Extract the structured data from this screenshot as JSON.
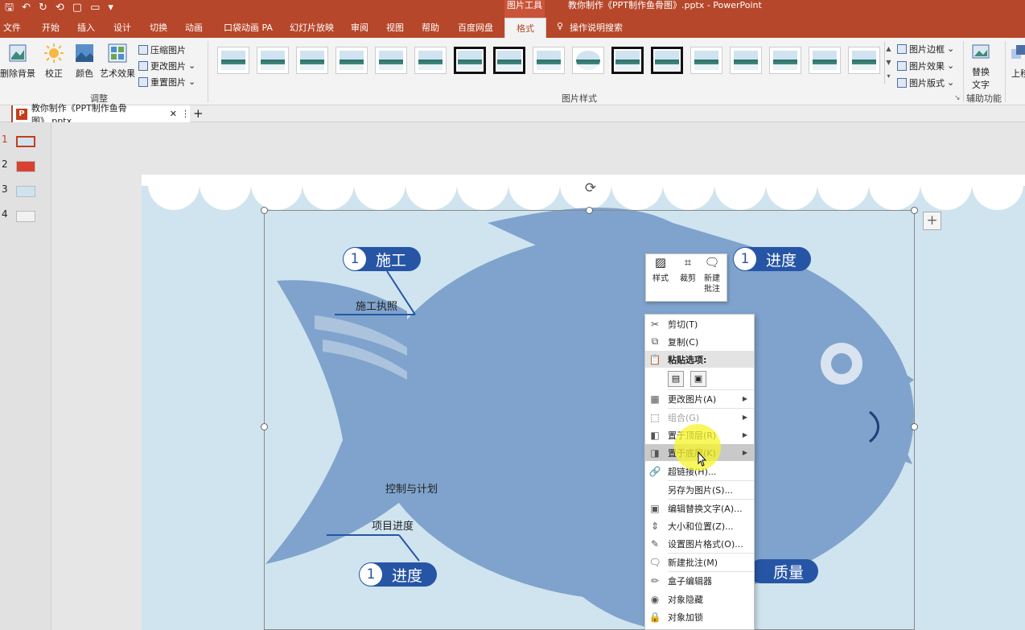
{
  "app": {
    "context_tab_label": "图片工具",
    "doc_title": "教你制作《PPT制作鱼骨图》.pptx  -  PowerPoint",
    "qat_icons": [
      "save-icon",
      "undo-icon",
      "redo-icon",
      "repeat-icon",
      "new-icon",
      "open-icon",
      "customize-icon"
    ]
  },
  "tabs": [
    "文件",
    "开始",
    "插入",
    "设计",
    "切换",
    "动画",
    "口袋动画 PA",
    "幻灯片放映",
    "审阅",
    "视图",
    "帮助",
    "百度网盘",
    "格式"
  ],
  "tell_me": "操作说明搜索",
  "ribbon": {
    "remove_bg": "删除背景",
    "correct": "校正",
    "color": "颜色",
    "artistic": "艺术效果",
    "compress": "压缩图片",
    "change": "更改图片",
    "reset": "重置图片",
    "adjust_group": "调整",
    "styles_group": "图片样式",
    "border": "图片边框",
    "effects": "图片效果",
    "layout": "图片版式",
    "alt_text_line1": "替换",
    "alt_text_line2": "文字",
    "accessibility_group": "辅助功能",
    "up": "上移"
  },
  "doctab": {
    "name": "教你制作《PPT制作鱼骨图》.pptx",
    "close": "✕",
    "more": "⋮",
    "add": "+"
  },
  "slides": [
    "1",
    "2",
    "3",
    "4"
  ],
  "slide": {
    "pill_top_left": {
      "num": "1",
      "label": "施工"
    },
    "pill_top_right": {
      "num": "1",
      "label": "进度"
    },
    "pill_bottom_left": {
      "num": "1",
      "label": "进度"
    },
    "pill_bottom_right": {
      "label": "质量"
    },
    "text_license": "施工执照",
    "text_control": "控制与计划",
    "text_progress": "项目进度"
  },
  "minibar": {
    "style": "样式",
    "crop": "裁剪",
    "comment_line1": "新建",
    "comment_line2": "批注"
  },
  "menu": {
    "cut": "剪切(T)",
    "copy": "复制(C)",
    "paste_options": "粘贴选项:",
    "change_picture": "更改图片(A)",
    "group": "组合(G)",
    "bring_front": "置于顶层(R)",
    "send_back": "置于底层(K)",
    "hyperlink": "超链接(H)...",
    "save_as": "另存为图片(S)...",
    "alt_text": "编辑替换文字(A)...",
    "size_pos": "大小和位置(Z)...",
    "format": "设置图片格式(O)...",
    "new_comment": "新建批注(M)",
    "box_editor": "盒子编辑器",
    "hide": "对象隐藏",
    "lock": "对象加锁"
  },
  "colors": {
    "accent": "#b7472a",
    "fish": "#7fa3cc",
    "pill": "#2755a6",
    "slide_bg": "#cfe4ef"
  }
}
